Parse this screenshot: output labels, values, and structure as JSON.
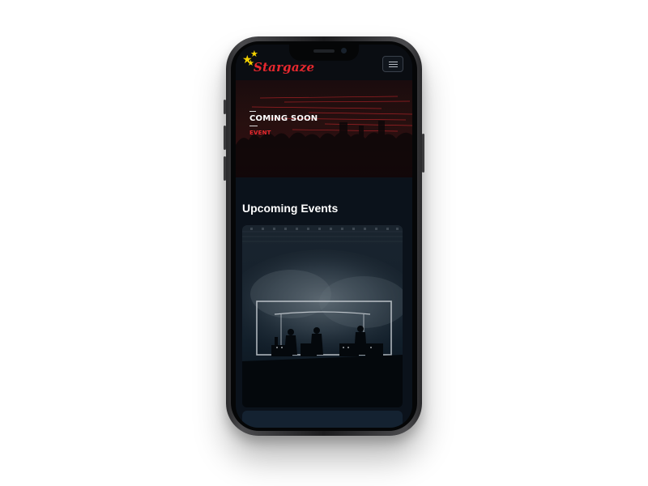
{
  "site": {
    "brand": "Stargaze",
    "menu_icon": "hamburger-icon"
  },
  "hero": {
    "title": "COMING SOON",
    "label": "EVENT",
    "accent_color": "#e8282e"
  },
  "main": {
    "section_title": "Upcoming Events"
  },
  "colors": {
    "page_bg": "#ffffff",
    "screen_bg": "#0b121b",
    "brand_red": "#e8282e",
    "star_yellow": "#f5d300"
  }
}
